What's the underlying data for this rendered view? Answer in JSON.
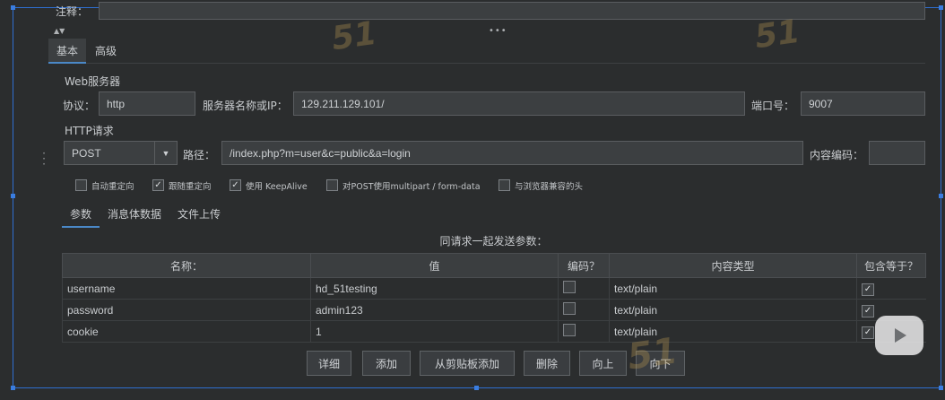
{
  "comment": {
    "label": "注释："
  },
  "tabs": [
    "基本",
    "高级"
  ],
  "web_server": {
    "section_label": "Web服务器",
    "protocol_label": "协议：",
    "protocol_value": "http",
    "server_label": "服务器名称或IP：",
    "server_value": "129.211.129.101/",
    "port_label": "端口号：",
    "port_value": "9007"
  },
  "http_request": {
    "section_label": "HTTP请求",
    "method_value": "POST",
    "path_label": "路径：",
    "path_value": "/index.php?m=user&c=public&a=login",
    "encoding_label": "内容编码："
  },
  "options": [
    {
      "label": "自动重定向",
      "checked": false
    },
    {
      "label": "跟随重定向",
      "checked": true
    },
    {
      "label": "使用 KeepAlive",
      "checked": true
    },
    {
      "label": "对POST使用multipart / form-data",
      "checked": false
    },
    {
      "label": "与浏览器兼容的头",
      "checked": false
    }
  ],
  "sub_tabs": [
    "参数",
    "消息体数据",
    "文件上传"
  ],
  "params": {
    "caption": "同请求一起发送参数：",
    "headers": [
      "名称：",
      "值",
      "编码？",
      "内容类型",
      "包含等于？"
    ],
    "rows": [
      {
        "name": "username",
        "value": "hd_51testing",
        "encode": false,
        "content_type": "text/plain",
        "include_equals": true
      },
      {
        "name": "password",
        "value": "admin123",
        "encode": false,
        "content_type": "text/plain",
        "include_equals": true
      },
      {
        "name": "cookie",
        "value": "1",
        "encode": false,
        "content_type": "text/plain",
        "include_equals": true
      }
    ]
  },
  "buttons": [
    "详细",
    "添加",
    "从剪贴板添加",
    "删除",
    "向上",
    "向下"
  ],
  "watermark_text": "51testing",
  "colors": {
    "background": "#2b2d2e",
    "field": "#3c3f41",
    "selection_frame": "#2f6fd0"
  }
}
